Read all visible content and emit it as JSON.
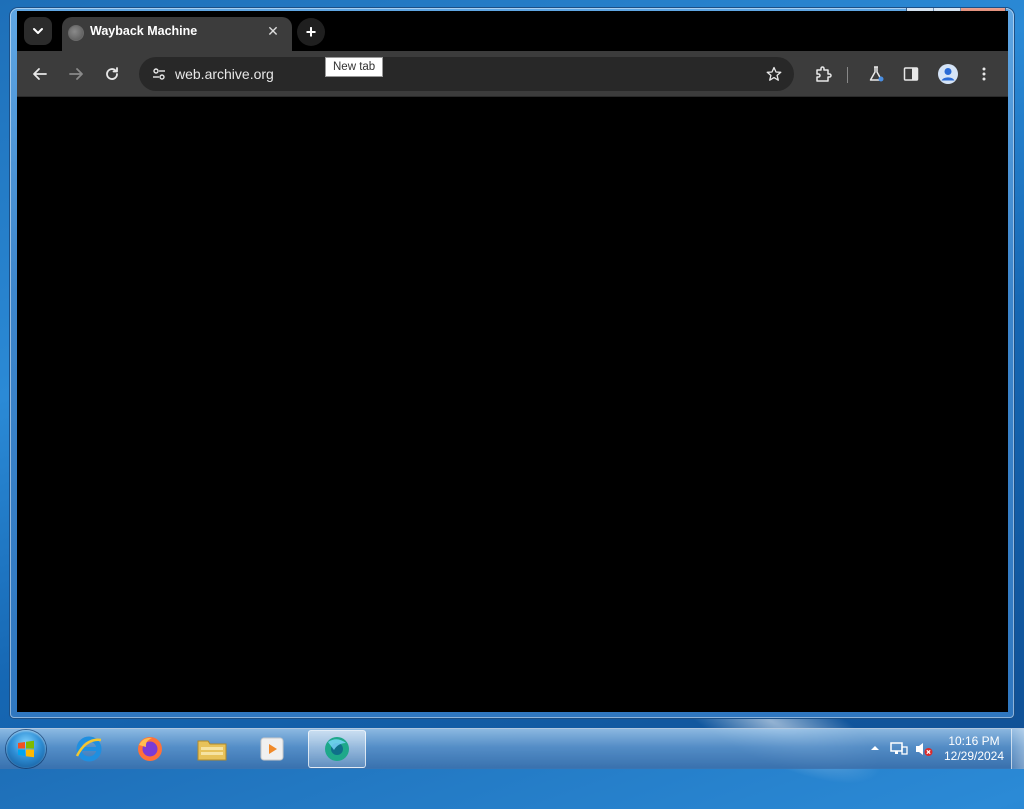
{
  "browser": {
    "tab": {
      "title": "Wayback Machine",
      "close_glyph": "✕",
      "favicon": "globe-icon"
    },
    "tooltip": "New tab",
    "new_tab_glyph": "+",
    "omnibox": {
      "url": "web.archive.org"
    },
    "toolbar_icons": [
      "back-icon",
      "forward-icon",
      "reload-icon",
      "site-settings-icon",
      "bookmark-star-icon",
      "extensions-icon",
      "labs-icon",
      "side-panel-icon",
      "profile-icon",
      "menu-icon"
    ]
  },
  "window": {
    "caption": {
      "minimize": "▁",
      "maximize": "□",
      "close": "✕"
    }
  },
  "taskbar": {
    "apps": [
      "internet-explorer-icon",
      "firefox-icon",
      "file-explorer-icon",
      "media-player-icon",
      "browser-active-icon"
    ],
    "clock": {
      "time": "10:16 PM",
      "date": "12/29/2024"
    }
  },
  "colors": {
    "chrome_dark": "#3c3c3c",
    "omnibox_bg": "#282828",
    "content_bg": "#000000",
    "accent_blue": "#1e6fb8"
  }
}
